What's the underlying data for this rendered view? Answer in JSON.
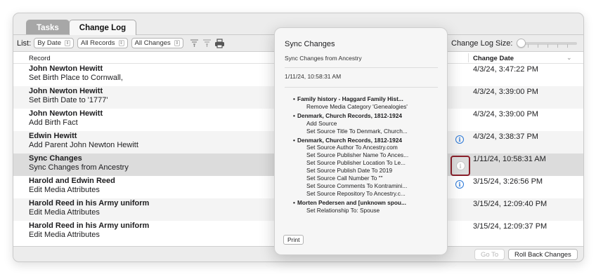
{
  "tabs": [
    {
      "label": "Tasks",
      "active": false
    },
    {
      "label": "Change Log",
      "active": true
    }
  ],
  "toolbar": {
    "list_label": "List:",
    "list_sort": "By Date",
    "records_filter": "All Records",
    "changes_filter": "All Changes",
    "size_label": "Change Log Size:",
    "size_value": 0
  },
  "table": {
    "columns": {
      "record": "Record",
      "date": "Change Date"
    },
    "rows": [
      {
        "title": "John Newton Hewitt",
        "change": "Set Birth Place to Cornwall,",
        "date": "4/3/24, 3:47:22 PM",
        "info": false
      },
      {
        "title": "John Newton Hewitt",
        "change": "Set Birth Date to '1777'",
        "date": "4/3/24, 3:39:00 PM",
        "info": false
      },
      {
        "title": "John Newton Hewitt",
        "change": "Add Birth Fact",
        "date": "4/3/24, 3:39:00 PM",
        "info": false
      },
      {
        "title": "Edwin Hewitt",
        "change": "Add Parent John Newton Hewitt",
        "date": "4/3/24, 3:38:37 PM",
        "info": true
      },
      {
        "title": "Sync Changes",
        "change": "Sync Changes from Ancestry",
        "date": "1/11/24, 10:58:31 AM",
        "info": true
      },
      {
        "title": "Harold and Edwin Reed",
        "change": "Edit Media Attributes",
        "date": "3/15/24, 3:26:56 PM",
        "info": true
      },
      {
        "title": "Harold Reed in his Army uniform",
        "change": "Edit Media Attributes",
        "date": "3/15/24, 12:09:40 PM",
        "info": false
      },
      {
        "title": "Harold Reed in his Army uniform",
        "change": "Edit Media Attributes",
        "date": "3/15/24, 12:09:37 PM",
        "info": false
      }
    ]
  },
  "buttons": {
    "go_to": "Go To",
    "roll_back": "Roll Back Changes"
  },
  "popover": {
    "title": "Sync Changes",
    "subtitle": "Sync Changes from Ancestry",
    "date": "1/11/24, 10:58:31 AM",
    "items": [
      {
        "heading": "Family history - Haggard Family Hist...",
        "details": [
          "Remove Media Category 'Genealogies'"
        ]
      },
      {
        "heading": "Denmark, Church Records, 1812-1924",
        "details": [
          "Add Source",
          "Set Source Title To Denmark, Church..."
        ]
      },
      {
        "heading": "Denmark, Church Records, 1812-1924",
        "details": [
          "Set Source Author To Ancestry.com",
          "Set Source Publisher Name To Ances...",
          "Set Source Publisher Location To Le...",
          "Set Source Publish Date To 2019",
          "Set Source Call Number To \"\"",
          "Set Source Comments To Kontramini...",
          "Set Source Repository To Ancestry.c..."
        ]
      },
      {
        "heading": "Morten Pedersen and [unknown spou...",
        "details": [
          "Set Relationship To: Spouse"
        ]
      }
    ],
    "print_label": "Print"
  },
  "icons": {
    "info": "info-circle-icon",
    "print": "printer-icon",
    "filter": "filter-icon"
  }
}
